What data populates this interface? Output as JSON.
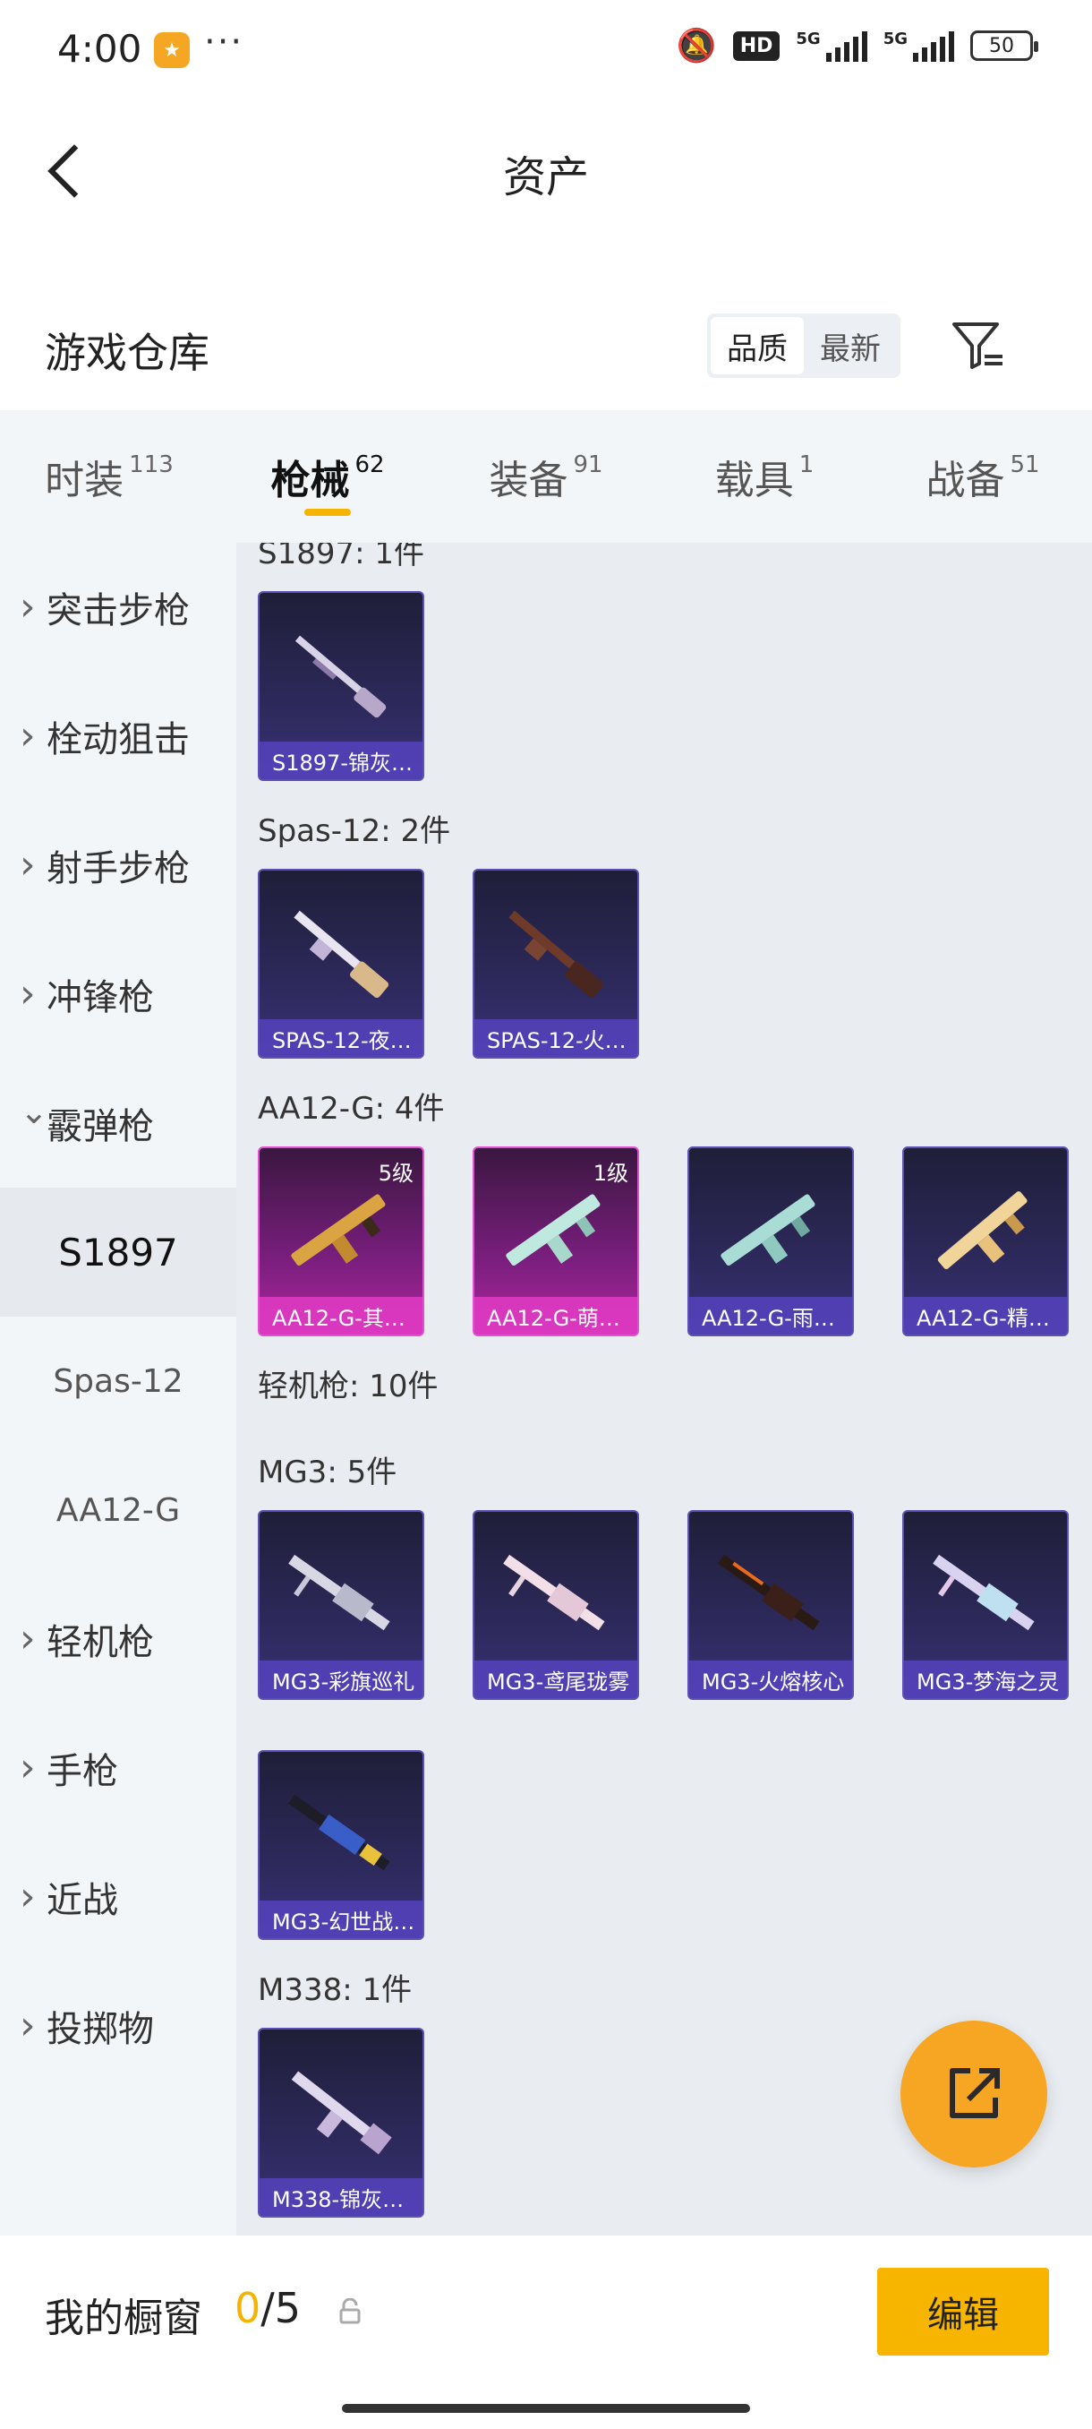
{
  "status_bar": {
    "time": "4:00",
    "app_icon": "app-icon",
    "more": "···",
    "hd": "HD",
    "net1": "5G",
    "net2": "5G",
    "battery": "50"
  },
  "header": {
    "title": "资产"
  },
  "section": {
    "title": "游戏仓库",
    "sort": [
      "品质",
      "最新"
    ],
    "sort_active": "品质"
  },
  "tabs": [
    {
      "label": "时装",
      "count": "113"
    },
    {
      "label": "枪械",
      "count": "62",
      "active": true
    },
    {
      "label": "装备",
      "count": "91"
    },
    {
      "label": "载具",
      "count": "1"
    },
    {
      "label": "战备",
      "count": "51"
    }
  ],
  "sidebar": {
    "items": [
      {
        "label": "突击步枪"
      },
      {
        "label": "栓动狙击"
      },
      {
        "label": "射手步枪"
      },
      {
        "label": "冲锋枪"
      },
      {
        "label": "霰弹枪",
        "expanded": true
      },
      {
        "label": "轻机枪"
      },
      {
        "label": "手枪"
      },
      {
        "label": "近战"
      },
      {
        "label": "投掷物"
      }
    ],
    "subitems": [
      {
        "label": "S1897",
        "active": true
      },
      {
        "label": "Spas-12"
      },
      {
        "label": "AA12-G"
      }
    ]
  },
  "content": {
    "groups": {
      "s1897": "S1897: 1件",
      "spas": "Spas-12: 2件",
      "aa12": "AA12-G: 4件",
      "lmg": "轻机枪: 10件",
      "mg3": "MG3: 5件",
      "m338": "M338: 1件"
    },
    "cards": {
      "s1897_1": "S1897-锦灰…",
      "spas_1": "SPAS-12-夜…",
      "spas_2": "SPAS-12-火…",
      "aa12_1": "AA12-G-其…",
      "aa12_1_level": "5级",
      "aa12_2": "AA12-G-萌…",
      "aa12_2_level": "1级",
      "aa12_3": "AA12-G-雨…",
      "aa12_4": "AA12-G-精…",
      "mg3_1": "MG3-彩旗巡礼",
      "mg3_2": "MG3-鸢尾珑雾",
      "mg3_3": "MG3-火熔核心",
      "mg3_4": "MG3-梦海之灵",
      "mg3_5": "MG3-幻世战…",
      "m338_1": "M338-锦灰…"
    }
  },
  "bottom": {
    "my_window": "我的橱窗",
    "current": "0",
    "total": "/5",
    "edit": "编辑"
  },
  "colors": {
    "accent": "#f7b500",
    "card_purple": "#2e2a5e",
    "card_pink": "#b0289e"
  }
}
